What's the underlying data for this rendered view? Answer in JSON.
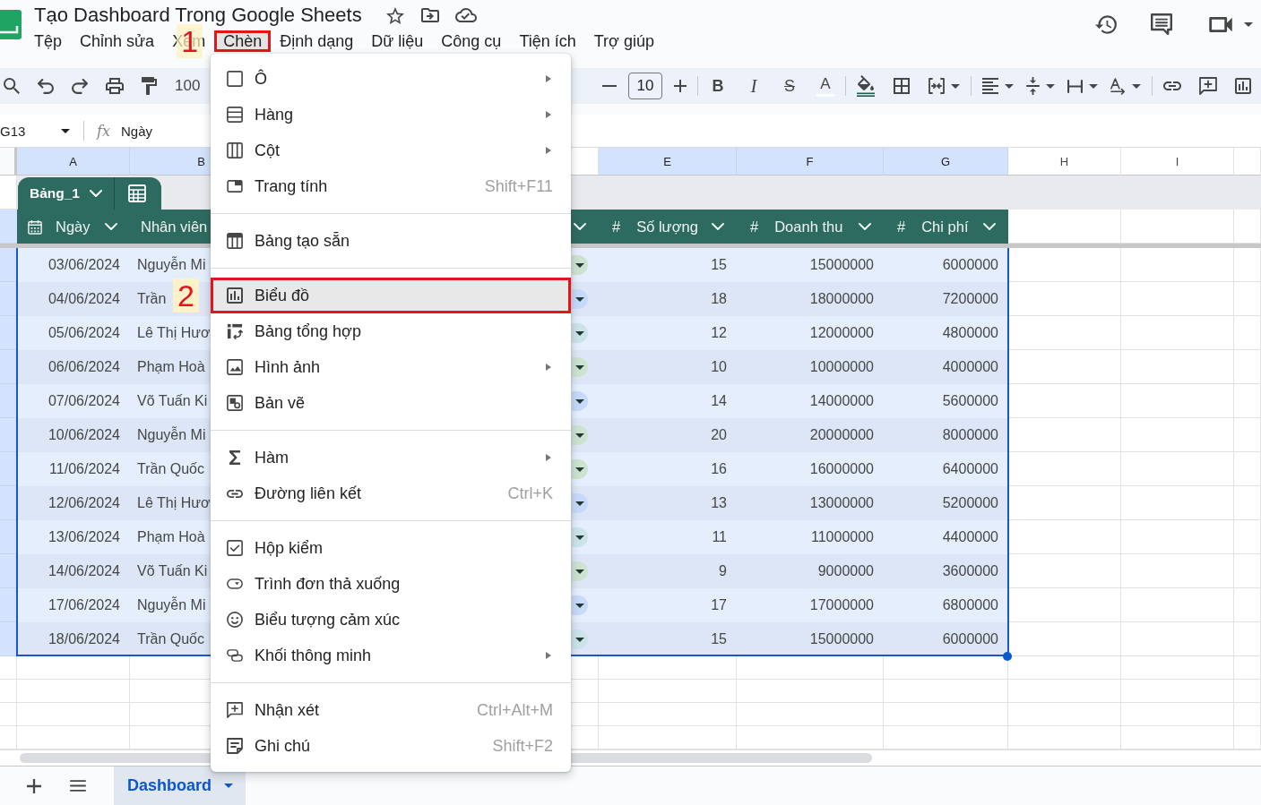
{
  "document": {
    "title": "Tạo Dashboard Trong Google Sheets"
  },
  "menu_bar": [
    {
      "label": "Tệp",
      "selected": false
    },
    {
      "label": "Chỉnh sửa",
      "selected": false
    },
    {
      "label": "Xem",
      "selected": false
    },
    {
      "label": "Chèn",
      "selected": true,
      "callout": "1"
    },
    {
      "label": "Định dạng",
      "selected": false
    },
    {
      "label": "Dữ liệu",
      "selected": false
    },
    {
      "label": "Công cụ",
      "selected": false
    },
    {
      "label": "Tiện ích",
      "selected": false
    },
    {
      "label": "Trợ giúp",
      "selected": false
    }
  ],
  "toolbar": {
    "zoom": "100",
    "font_size": "10",
    "text_styles": [
      {
        "kind": "bold",
        "label": "B"
      },
      {
        "kind": "italic",
        "label": "I"
      },
      {
        "kind": "strikethrough",
        "label": "S"
      },
      {
        "kind": "text_color",
        "label": "A"
      }
    ]
  },
  "formula_bar": {
    "cell_reference": "G13",
    "function_symbol": "fx",
    "content": "Ngày"
  },
  "column_headers": [
    {
      "letter": "A",
      "selected": true
    },
    {
      "letter": "B",
      "selected": true
    },
    {
      "letter": "E",
      "selected": true
    },
    {
      "letter": "F",
      "selected": true
    },
    {
      "letter": "G",
      "selected": true
    },
    {
      "letter": "H",
      "selected": false
    },
    {
      "letter": "I",
      "selected": false
    }
  ],
  "table": {
    "name": "Bảng_1",
    "columns": [
      {
        "kind": "date",
        "label": "Ngày"
      },
      {
        "kind": "text",
        "label": "Nhân viên"
      },
      {
        "kind": "dropdown"
      },
      {
        "kind": "number",
        "symbol": "#",
        "label": "Số lượng"
      },
      {
        "kind": "number",
        "symbol": "#",
        "label": "Doanh thu"
      },
      {
        "kind": "number",
        "symbol": "#",
        "label": "Chi phí"
      }
    ],
    "rows": [
      {
        "date": "03/06/2024",
        "employee": "Nguyễn Mi",
        "chip": {
          "color": "#cde3d0"
        },
        "quantity": "15",
        "revenue": "15000000",
        "cost": "6000000"
      },
      {
        "date": "04/06/2024",
        "employee": "Trần",
        "chip": {
          "color": "#c6dafc"
        },
        "quantity": "18",
        "revenue": "18000000",
        "cost": "7200000"
      },
      {
        "date": "05/06/2024",
        "employee": "Lê Thị Hươ",
        "chip": {
          "color": "#cbe4ea"
        },
        "quantity": "12",
        "revenue": "12000000",
        "cost": "4800000"
      },
      {
        "date": "06/06/2024",
        "employee": "Phạm Hoà",
        "chip": {
          "color": "#cde3d0"
        },
        "quantity": "10",
        "revenue": "10000000",
        "cost": "4000000"
      },
      {
        "date": "07/06/2024",
        "employee": "Võ Tuấn Ki",
        "chip": {
          "color": "#c6dafc"
        },
        "quantity": "14",
        "revenue": "14000000",
        "cost": "5600000"
      },
      {
        "date": "10/06/2024",
        "employee": "Nguyễn Mi",
        "chip": {
          "color": "#cde3d0"
        },
        "quantity": "20",
        "revenue": "20000000",
        "cost": "8000000"
      },
      {
        "date": "11/06/2024",
        "employee": "Trần Quốc",
        "chip": {
          "color": "#cde3d0"
        },
        "quantity": "16",
        "revenue": "16000000",
        "cost": "6400000"
      },
      {
        "date": "12/06/2024",
        "employee": "Lê Thị Hươ",
        "chip": {
          "color": "#c6dafc"
        },
        "quantity": "13",
        "revenue": "13000000",
        "cost": "5200000"
      },
      {
        "date": "13/06/2024",
        "employee": "Phạm Hoà",
        "chip": {
          "color": "#cbe4ea"
        },
        "quantity": "11",
        "revenue": "11000000",
        "cost": "4400000"
      },
      {
        "date": "14/06/2024",
        "employee": "Võ Tuấn Ki",
        "chip": {
          "color": "#cde3d0"
        },
        "quantity": "9",
        "revenue": "9000000",
        "cost": "3600000"
      },
      {
        "date": "17/06/2024",
        "employee": "Nguyễn Mi",
        "chip": {
          "color": "#c6dafc"
        },
        "quantity": "17",
        "revenue": "17000000",
        "cost": "6800000"
      },
      {
        "date": "18/06/2024",
        "employee": "Trần Quốc",
        "chip": {
          "color": "#cbe4ea"
        },
        "quantity": "15",
        "revenue": "15000000",
        "cost": "6000000"
      }
    ]
  },
  "insert_menu": {
    "groups": [
      [
        {
          "label": "Ô",
          "submenu": true,
          "selected": false
        },
        {
          "label": "Hàng",
          "submenu": true,
          "selected": false
        },
        {
          "label": "Cột",
          "submenu": true,
          "selected": false
        },
        {
          "label": "Trang tính",
          "shortcut": "Shift+F11",
          "submenu": false,
          "selected": false
        }
      ],
      [
        {
          "label": "Bảng tạo sẵn",
          "submenu": false,
          "selected": false
        }
      ],
      [
        {
          "label": "Biểu đồ",
          "submenu": false,
          "selected": true,
          "callout": "2"
        },
        {
          "label": "Bảng tổng hợp",
          "submenu": false,
          "selected": false
        },
        {
          "label": "Hình ảnh",
          "submenu": true,
          "selected": false
        },
        {
          "label": "Bản vẽ",
          "submenu": false,
          "selected": false
        }
      ],
      [
        {
          "label": "Hàm",
          "submenu": true,
          "selected": false
        },
        {
          "label": "Đường liên kết",
          "shortcut": "Ctrl+K",
          "submenu": false,
          "selected": false
        }
      ],
      [
        {
          "label": "Hộp kiểm",
          "submenu": false,
          "selected": false
        },
        {
          "label": "Trình đơn thả xuống",
          "submenu": false,
          "selected": false
        },
        {
          "label": "Biểu tượng cảm xúc",
          "submenu": false,
          "selected": false
        },
        {
          "label": "Khối thông minh",
          "submenu": true,
          "selected": false
        }
      ],
      [
        {
          "label": "Nhận xét",
          "shortcut": "Ctrl+Alt+M",
          "submenu": false,
          "selected": false
        },
        {
          "label": "Ghi chú",
          "shortcut": "Shift+F2",
          "submenu": false,
          "selected": false
        }
      ]
    ]
  },
  "sheet_tabs": [
    {
      "label": "Dashboard",
      "selected": true
    }
  ]
}
